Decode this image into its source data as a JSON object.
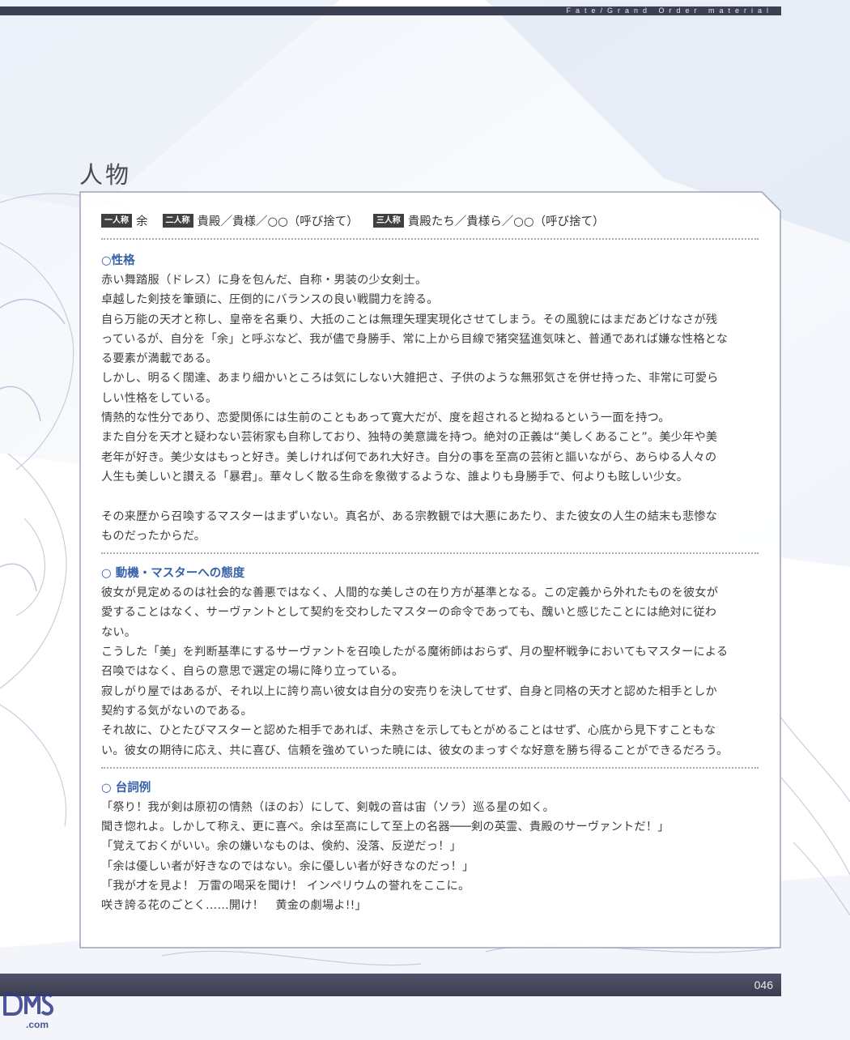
{
  "header": {
    "series": "Fate/Grand Order material",
    "bar_color": "#3d3f52"
  },
  "section_title": "人物",
  "pronouns": {
    "first_label": "一人称",
    "first_value": "余",
    "second_label": "二人称",
    "second_value": "貴殿／貴様／○○（呼び捨て）",
    "third_label": "三人称",
    "third_value": "貴殿たち／貴様ら／○○（呼び捨て）"
  },
  "personality": {
    "heading": "○性格",
    "lines": [
      "赤い舞踏服（ドレス）に身を包んだ、自称・男装の少女剣士。",
      "卓越した剣技を筆頭に、圧倒的にバランスの良い戦闘力を誇る。",
      "自ら万能の天才と称し、皇帝を名乗り、大抵のことは無理矢理実現化させてしまう。その風貌にはまだあどけなさが残",
      "っているが、自分を「余」と呼ぶなど、我が儘で身勝手、常に上から目線で猪突猛進気味と、普通であれば嫌な性格とな",
      "る要素が満載である。",
      "しかし、明るく闊達、あまり細かいところは気にしない大雑把さ、子供のような無邪気さを併せ持った、非常に可愛ら",
      "しい性格をしている。",
      "情熱的な性分であり、恋愛関係には生前のこともあって寛大だが、度を超されると拗ねるという一面を持つ。",
      "また自分を天才と疑わない芸術家も自称しており、独特の美意識を持つ。絶対の正義は“美しくあること”。美少年や美",
      "老年が好き。美少女はもっと好き。美しければ何であれ大好き。自分の事を至高の芸術と謳いながら、あらゆる人々の",
      "人生も美しいと讃える「暴君」。華々しく散る生命を象徴するような、誰よりも身勝手で、何よりも眩しい少女。",
      "",
      "その来歴から召喚するマスターはまずいない。真名が、ある宗教観では大悪にあたり、また彼女の人生の結末も悲惨な",
      "ものだったからだ。"
    ]
  },
  "motivation": {
    "heading": "○ 動機・マスターへの態度",
    "lines": [
      "彼女が見定めるのは社会的な善悪ではなく、人間的な美しさの在り方が基準となる。この定義から外れたものを彼女が",
      "愛することはなく、サーヴァントとして契約を交わしたマスターの命令であっても、醜いと感じたことには絶対に従わ",
      "ない。",
      "こうした「美」を判断基準にするサーヴァントを召喚したがる魔術師はおらず、月の聖杯戦争においてもマスターによる",
      "召喚ではなく、自らの意思で選定の場に降り立っている。",
      "寂しがり屋ではあるが、それ以上に誇り高い彼女は自分の安売りを決してせず、自身と同格の天才と認めた相手としか",
      "契約する気がないのである。",
      "それ故に、ひとたびマスターと認めた相手であれば、未熟さを示してもとがめることはせず、心底から見下すこともな",
      "い。彼女の期待に応え、共に喜び、信頼を強めていった暁には、彼女のまっすぐな好意を勝ち得ることができるだろう。"
    ]
  },
  "quotes": {
    "heading": "○ 台詞例",
    "lines": [
      "「祭り！我が剣は原初の情熱（ほのお）にして、剣戟の音は宙（ソラ）巡る星の如く。",
      "聞き惚れよ。しかして称え、更に喜べ。余は至高にして至上の名器───剣の英霊、貴殿のサーヴァントだ！」",
      "「覚えておくがいい。余の嫌いなものは、倹約、没落、反逆だっ！」",
      "「余は優しい者が好きなのではない。余に優しい者が好きなのだっ！」",
      "「我が才を見よ！ 万雷の喝采を聞け！ インペリウムの誉れをここに。",
      "咲き誇る花のごとく……開け！　黄金の劇場よ!!」"
    ]
  },
  "page_number": "046",
  "watermark": "DMS.com",
  "colors": {
    "heading_blue": "#3562a8",
    "panel_border": "#9da3b8",
    "bottom_bar": "#3b3d50"
  }
}
